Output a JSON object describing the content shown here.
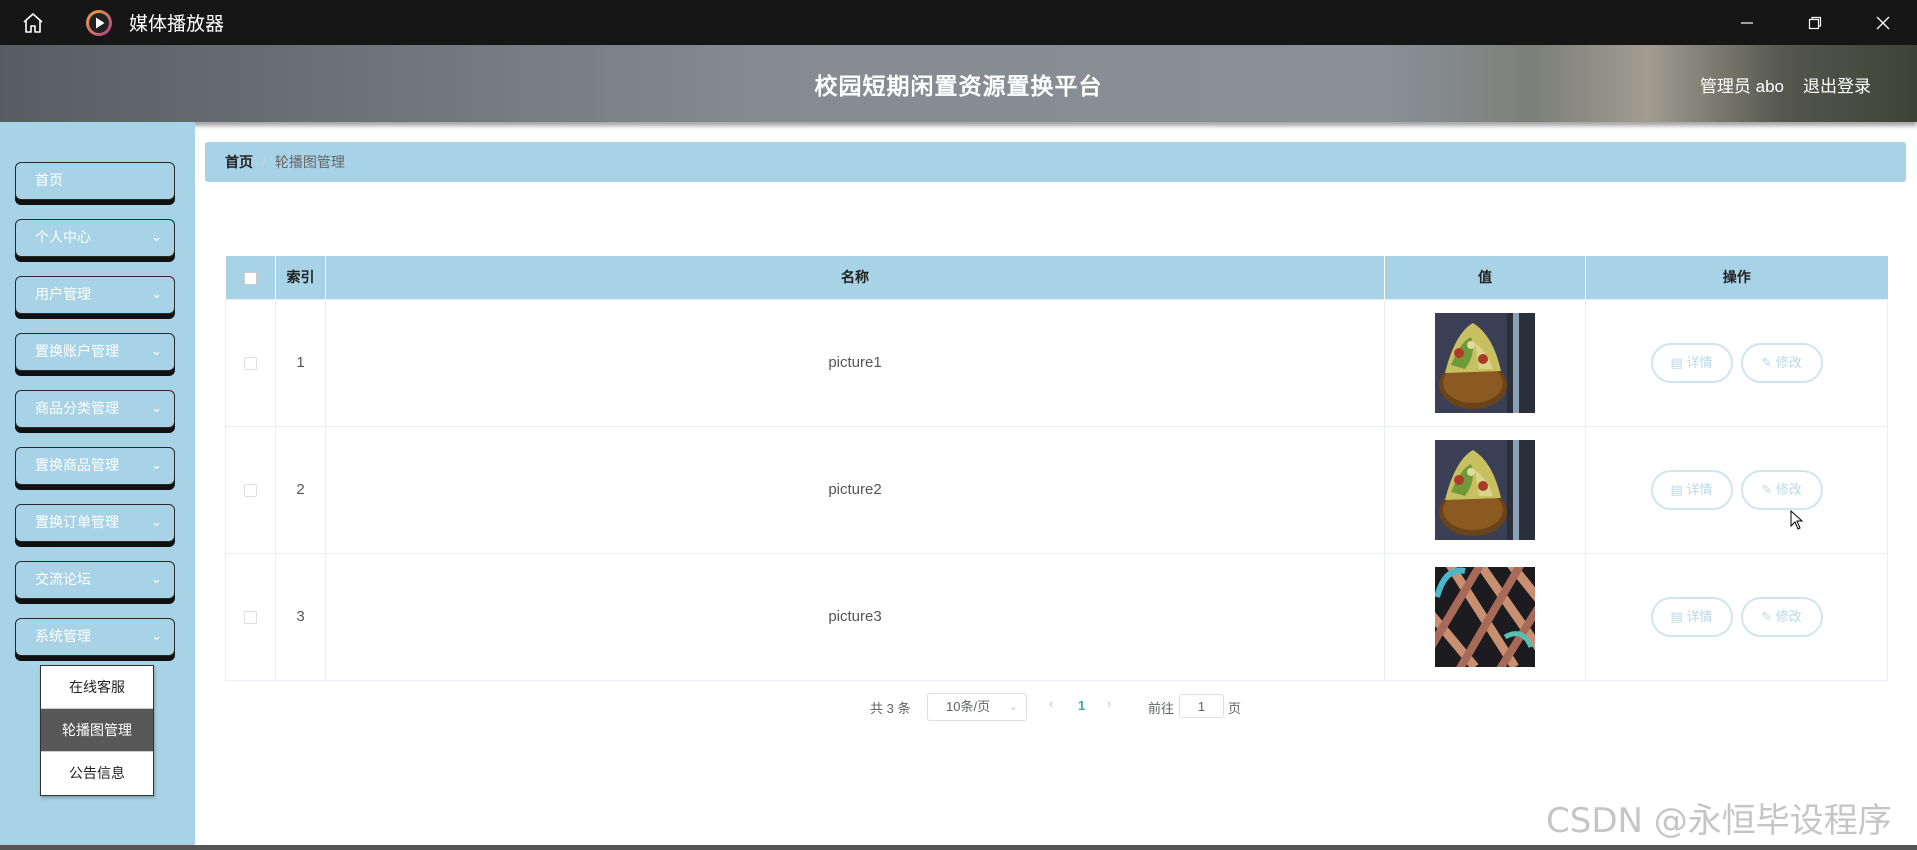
{
  "titlebar": {
    "app_title": "媒体播放器"
  },
  "header": {
    "site_title": "校园短期闲置资源置换平台",
    "admin_label": "管理员 abo",
    "logout_label": "退出登录"
  },
  "sidebar": {
    "items": [
      {
        "label": "首页",
        "has_submenu": false
      },
      {
        "label": "个人中心",
        "has_submenu": true
      },
      {
        "label": "用户管理",
        "has_submenu": true
      },
      {
        "label": "置换账户管理",
        "has_submenu": true
      },
      {
        "label": "商品分类管理",
        "has_submenu": true
      },
      {
        "label": "置换商品管理",
        "has_submenu": true
      },
      {
        "label": "置换订单管理",
        "has_submenu": true
      },
      {
        "label": "交流论坛",
        "has_submenu": true
      },
      {
        "label": "系统管理",
        "has_submenu": true
      }
    ],
    "submenu": [
      {
        "label": "在线客服",
        "active": false
      },
      {
        "label": "轮播图管理",
        "active": true
      },
      {
        "label": "公告信息",
        "active": false
      }
    ]
  },
  "breadcrumb": {
    "home": "首页",
    "separator": "/",
    "current": "轮播图管理"
  },
  "table": {
    "headers": {
      "index": "索引",
      "name": "名称",
      "value": "值",
      "ops": "操作"
    },
    "rows": [
      {
        "index": "1",
        "name": "picture1",
        "image": "food-bowl"
      },
      {
        "index": "2",
        "name": "picture2",
        "image": "food-bowl"
      },
      {
        "index": "3",
        "name": "picture3",
        "image": "mural"
      }
    ],
    "detail_label": "详情",
    "edit_label": "修改"
  },
  "pagination": {
    "total": "共 3 条",
    "page_size": "10条/页",
    "current_page": "1",
    "goto_label": "前往",
    "goto_value": "1",
    "page_unit": "页"
  },
  "watermark": "CSDN @永恒毕设程序",
  "colors": {
    "accent": "#a8d2e5",
    "titlebar": "#161616",
    "page_active": "#3fa9a0"
  }
}
